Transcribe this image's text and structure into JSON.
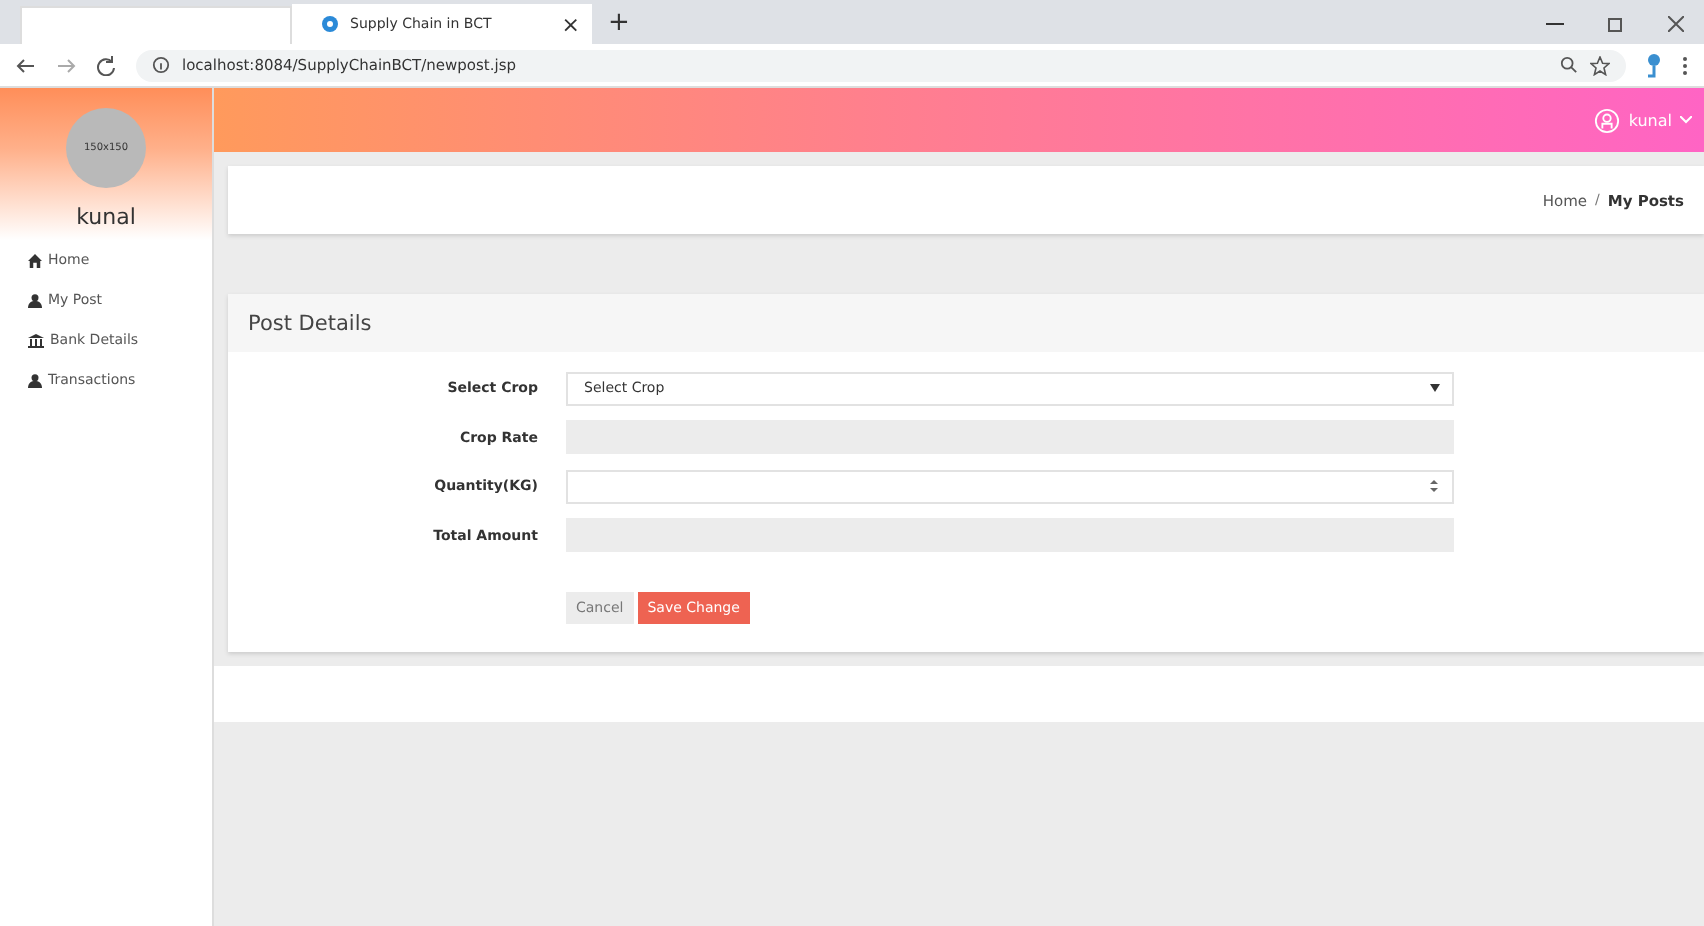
{
  "browser": {
    "tab_title": "Supply Chain in BCT",
    "tab_close": "×",
    "new_tab": "+",
    "url": "localhost:8084/SupplyChainBCT/newpost.jsp"
  },
  "sidebar": {
    "avatar_text": "150x150",
    "user_name": "kunal",
    "items": [
      {
        "label": "Home",
        "selected": false
      },
      {
        "label": "My Post",
        "selected": false
      },
      {
        "label": "Bank Details",
        "selected": false
      },
      {
        "label": "Transactions",
        "selected": false
      }
    ]
  },
  "header": {
    "user_name": "kunal"
  },
  "breadcrumb": [
    {
      "label": "Home",
      "current": false
    },
    {
      "label": "My Posts",
      "current": true
    }
  ],
  "breadcrumb_separator": "/",
  "panel": {
    "title": "Post Details",
    "fields": [
      {
        "label": "Select Crop",
        "kind": "select",
        "value": "Select Crop",
        "disabled": false
      },
      {
        "label": "Crop Rate",
        "kind": "text",
        "disabled": true
      },
      {
        "label": "Quantity(KG)",
        "kind": "number",
        "disabled": false
      },
      {
        "label": "Total Amount",
        "kind": "text",
        "disabled": true
      }
    ],
    "buttons": [
      {
        "label": "Cancel",
        "kind": "secondary"
      },
      {
        "label": "Save Change",
        "kind": "primary"
      }
    ]
  }
}
